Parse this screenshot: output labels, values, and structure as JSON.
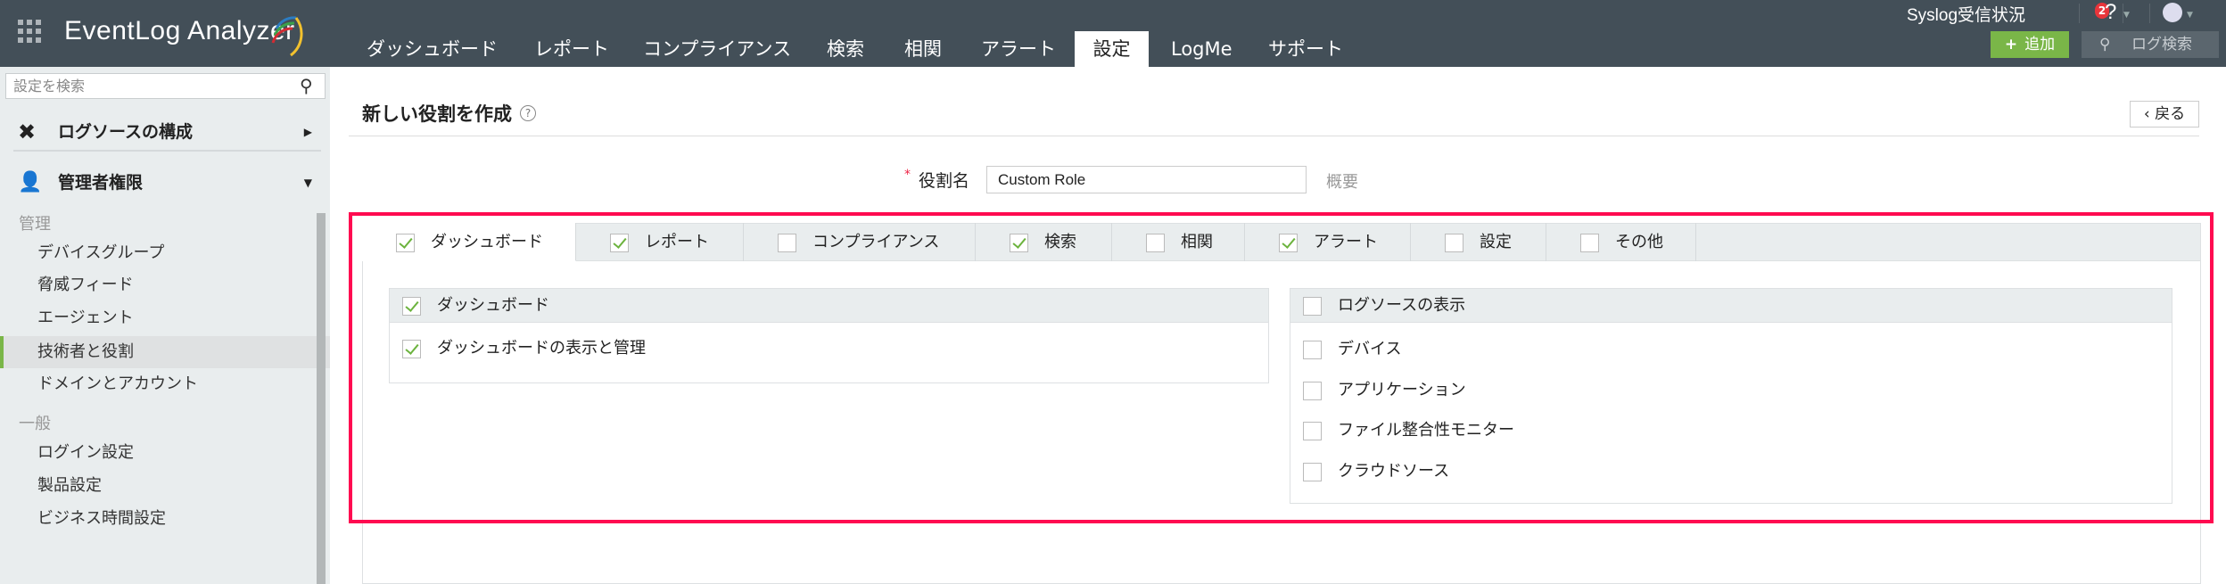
{
  "header": {
    "app_name": "EventLog Analyzer",
    "nav": [
      "ダッシュボード",
      "レポート",
      "コンプライアンス",
      "検索",
      "相関",
      "アラート",
      "設定",
      "LogMe",
      "サポート"
    ],
    "active_nav": "設定",
    "syslog_status": "Syslog受信状況",
    "notification_count": "2",
    "help": "?",
    "add_label": "追加",
    "log_search_label": "ログ検索",
    "brand_color": "#7ab648"
  },
  "sidebar": {
    "search_placeholder": "設定を検索",
    "sections": [
      {
        "label": "ログソースの構成"
      },
      {
        "label": "管理者権限"
      }
    ],
    "groups": [
      {
        "label": "管理",
        "items": [
          "デバイスグループ",
          "脅威フィード",
          "エージェント",
          "技術者と役割",
          "ドメインとアカウント"
        ]
      },
      {
        "label": "一般",
        "items": [
          "ログイン設定",
          "製品設定",
          "ビジネス時間設定"
        ]
      }
    ],
    "active_item": "技術者と役割"
  },
  "main": {
    "title": "新しい役割を作成",
    "help": "?",
    "back_label": "戻る",
    "role_name_label": "役割名",
    "required_mark": "*",
    "role_name_value": "Custom Role",
    "description_label": "概要",
    "tabs": [
      {
        "label": "ダッシュボード",
        "checked": true
      },
      {
        "label": "レポート",
        "checked": true
      },
      {
        "label": "コンプライアンス",
        "checked": false
      },
      {
        "label": "検索",
        "checked": true
      },
      {
        "label": "相関",
        "checked": false
      },
      {
        "label": "アラート",
        "checked": true
      },
      {
        "label": "設定",
        "checked": false
      },
      {
        "label": "その他",
        "checked": false
      }
    ],
    "left_panel": {
      "header": "ダッシュボード",
      "items": [
        "ダッシュボードの表示と管理"
      ]
    },
    "right_panel": {
      "header": "ログソースの表示",
      "items": [
        "デバイス",
        "アプリケーション",
        "ファイル整合性モニター",
        "クラウドソース"
      ]
    }
  }
}
